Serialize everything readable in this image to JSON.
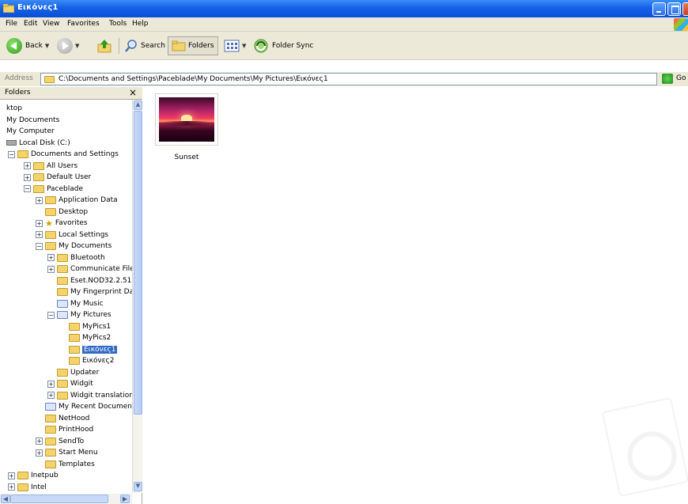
{
  "window": {
    "title": "Εικόνες1"
  },
  "menu": [
    "File",
    "Edit",
    "View",
    "Favorites",
    "Tools",
    "Help"
  ],
  "toolbar": {
    "back_label": "Back",
    "search_label": "Search",
    "folders_label": "Folders",
    "folder_sync_label": "Folder Sync"
  },
  "address": {
    "label": "Address",
    "path": "C:\\Documents and Settings\\Paceblade\\My Documents\\My Pictures\\Εικόνες1",
    "go_label": "Go"
  },
  "folders_pane": {
    "title": "Folders",
    "nodes": [
      {
        "label": "ktop",
        "icon": "none",
        "expander": "",
        "level": 0
      },
      {
        "label": "My Documents",
        "icon": "none",
        "expander": "",
        "level": 0
      },
      {
        "label": "My Computer",
        "icon": "none",
        "expander": "",
        "level": 0
      },
      {
        "label": "Local Disk (C:)",
        "icon": "drive",
        "expander": "",
        "level": 0
      },
      {
        "label": "Documents and Settings",
        "icon": "folder",
        "expander": "−",
        "level": 1
      },
      {
        "label": "All Users",
        "icon": "folder",
        "expander": "+",
        "level": 2
      },
      {
        "label": "Default User",
        "icon": "folder",
        "expander": "+",
        "level": 2
      },
      {
        "label": "Paceblade",
        "icon": "folder",
        "expander": "−",
        "level": 2
      },
      {
        "label": "Application Data",
        "icon": "folder",
        "expander": "+",
        "level": 3
      },
      {
        "label": "Desktop",
        "icon": "folder",
        "expander": "",
        "level": 3
      },
      {
        "label": "Favorites",
        "icon": "star",
        "expander": "+",
        "level": 3
      },
      {
        "label": "Local Settings",
        "icon": "folder",
        "expander": "+",
        "level": 3
      },
      {
        "label": "My Documents",
        "icon": "folder",
        "expander": "−",
        "level": 3
      },
      {
        "label": "Bluetooth",
        "icon": "folder",
        "expander": "+",
        "level": 4
      },
      {
        "label": "Communicate File",
        "icon": "folder",
        "expander": "+",
        "level": 4
      },
      {
        "label": "Eset.NOD32.2.51",
        "icon": "folder",
        "expander": "",
        "level": 4
      },
      {
        "label": "My Fingerprint Da",
        "icon": "folder",
        "expander": "",
        "level": 4
      },
      {
        "label": "My Music",
        "icon": "special",
        "expander": "",
        "level": 4
      },
      {
        "label": "My Pictures",
        "icon": "special",
        "expander": "−",
        "level": 4
      },
      {
        "label": "MyPics1",
        "icon": "folder",
        "expander": "",
        "level": 5
      },
      {
        "label": "MyPics2",
        "icon": "folder",
        "expander": "",
        "level": 5
      },
      {
        "label": "Εικόνες1",
        "icon": "folder",
        "expander": "",
        "level": 5,
        "selected": true
      },
      {
        "label": "Εικόνες2",
        "icon": "folder",
        "expander": "",
        "level": 5
      },
      {
        "label": "Updater",
        "icon": "folder",
        "expander": "",
        "level": 4
      },
      {
        "label": "Widgit",
        "icon": "folder",
        "expander": "+",
        "level": 4
      },
      {
        "label": "Widgit translation",
        "icon": "folder",
        "expander": "+",
        "level": 4
      },
      {
        "label": "My Recent Documents",
        "icon": "special",
        "expander": "",
        "level": 3
      },
      {
        "label": "NetHood",
        "icon": "folder",
        "expander": "",
        "level": 3
      },
      {
        "label": "PrintHood",
        "icon": "folder",
        "expander": "",
        "level": 3
      },
      {
        "label": "SendTo",
        "icon": "folder",
        "expander": "+",
        "level": 3
      },
      {
        "label": "Start Menu",
        "icon": "folder",
        "expander": "+",
        "level": 3
      },
      {
        "label": "Templates",
        "icon": "folder",
        "expander": "",
        "level": 3
      },
      {
        "label": "Inetpub",
        "icon": "folder",
        "expander": "+",
        "level": 1
      },
      {
        "label": "Intel",
        "icon": "folder",
        "expander": "+",
        "level": 1
      }
    ]
  },
  "content": {
    "items": [
      {
        "label": "Sunset",
        "thumbnail": "sunset"
      }
    ]
  }
}
